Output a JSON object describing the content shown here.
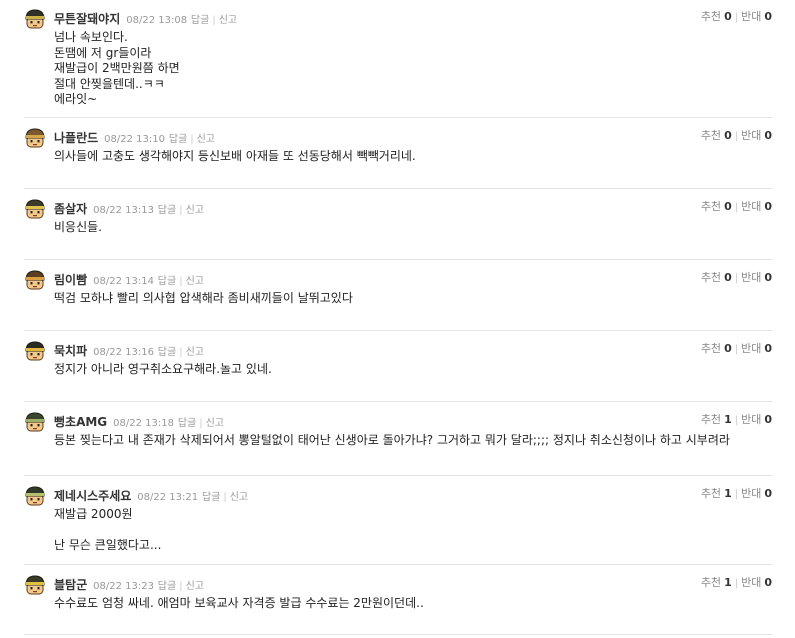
{
  "labels": {
    "reply": "답글",
    "report": "신고",
    "up": "추천",
    "down": "반대"
  },
  "comments": [
    {
      "nick": "무튼잘돼야지",
      "time": "08/22 13:08",
      "body": "넘나 속보인다.\n돈땜에 저 gr들이라\n재발급이 2백만원쯤 하면\n절대 안찢을텐데..ㅋㅋ\n에라잇~",
      "up": "0",
      "down": "0",
      "helmet": "#2f3327",
      "band": "#c9b24a"
    },
    {
      "nick": "나플란드",
      "time": "08/22 13:10",
      "body": "의사들에 고충도 생각해야지 등신보배 아재들 또 선동당해서 빽빽거리네.",
      "up": "0",
      "down": "0",
      "helmet": "#7a5a2e",
      "band": "#d8a64a"
    },
    {
      "nick": "좀살자",
      "time": "08/22 13:13",
      "body": "비응신들.",
      "up": "0",
      "down": "0",
      "helmet": "#3b3b2a",
      "band": "#e0c050"
    },
    {
      "nick": "림이빰",
      "time": "08/22 13:14",
      "body": "떡검 모하냐 빨리 의사협 압색해라 좀비새끼들이 날뛰고있다",
      "up": "0",
      "down": "0",
      "helmet": "#5a3d22",
      "band": "#d8a040"
    },
    {
      "nick": "묵치파",
      "time": "08/22 13:16",
      "body": "정지가 아니라 영구취소요구해라.놀고 있네.",
      "up": "0",
      "down": "0",
      "helmet": "#2b2b22",
      "band": "#e2b93c"
    },
    {
      "nick": "뻥초AMG",
      "time": "08/22 13:18",
      "body": "등본 찢는다고 내 존재가 삭제되어서 뽕알털없이 태어난 신생아로 돌아가냐? 그거하고 뭐가 달라;;;; 정지나 취소신청이나 하고 시부려라",
      "up": "1",
      "down": "0",
      "helmet": "#3a4530",
      "band": "#9cb06a"
    },
    {
      "nick": "제네시스주세요",
      "time": "08/22 13:21",
      "body": "재발급 2000원\n\n난 무슨 큰일했다고...",
      "up": "1",
      "down": "0",
      "helmet": "#2f3a2a",
      "band": "#b7c070"
    },
    {
      "nick": "블탐군",
      "time": "08/22 13:23",
      "body": "수수료도 엄청 싸네. 애엄마 보육교사 자격증 발급 수수료는 2만원이던데..",
      "up": "1",
      "down": "0",
      "helmet": "#3a3a28",
      "band": "#e0c040"
    }
  ]
}
